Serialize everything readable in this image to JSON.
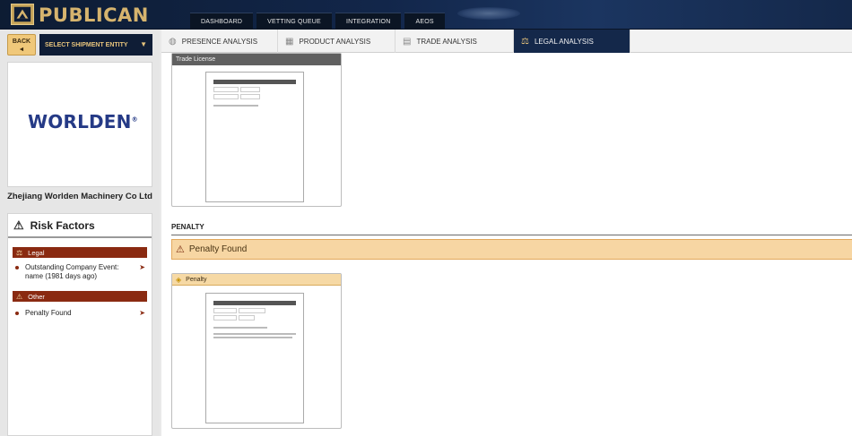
{
  "app": {
    "brand": "PUBLICAN",
    "nav": [
      "DASHBOARD",
      "VETTING QUEUE",
      "INTEGRATION",
      "AEOS"
    ]
  },
  "sidebar": {
    "back_label": "BACK",
    "back_arrow": "◄",
    "entity_select": "SELECT SHIPMENT ENTITY",
    "entity_chevron": "▼",
    "company_logo": "WORLDEN",
    "company_logo_mark": "®",
    "company_name": "Zhejiang Worlden Machinery Co Ltd",
    "risk_title": "Risk Factors",
    "categories": [
      {
        "label": "Legal",
        "items": [
          "Outstanding Company Event: name (1981 days ago)"
        ]
      },
      {
        "label": "Other",
        "items": [
          "Penalty Found"
        ]
      }
    ]
  },
  "tabs": [
    {
      "label": "PRESENCE ANALYSIS",
      "icon": "globe-icon"
    },
    {
      "label": "PRODUCT ANALYSIS",
      "icon": "boxes-icon"
    },
    {
      "label": "TRADE ANALYSIS",
      "icon": "ship-icon"
    },
    {
      "label": "LEGAL ANALYSIS",
      "icon": "gavel-icon",
      "active": true
    }
  ],
  "main": {
    "trade_license_title": "Trade License",
    "penalty_section": "PENALTY",
    "penalty_alert": "Penalty Found",
    "penalty_card_title": "Penalty"
  },
  "colors": {
    "navy": "#14284a",
    "gold": "#d6b46e",
    "risk_red": "#8a2a11",
    "alert_bg": "#f7d6a3"
  }
}
